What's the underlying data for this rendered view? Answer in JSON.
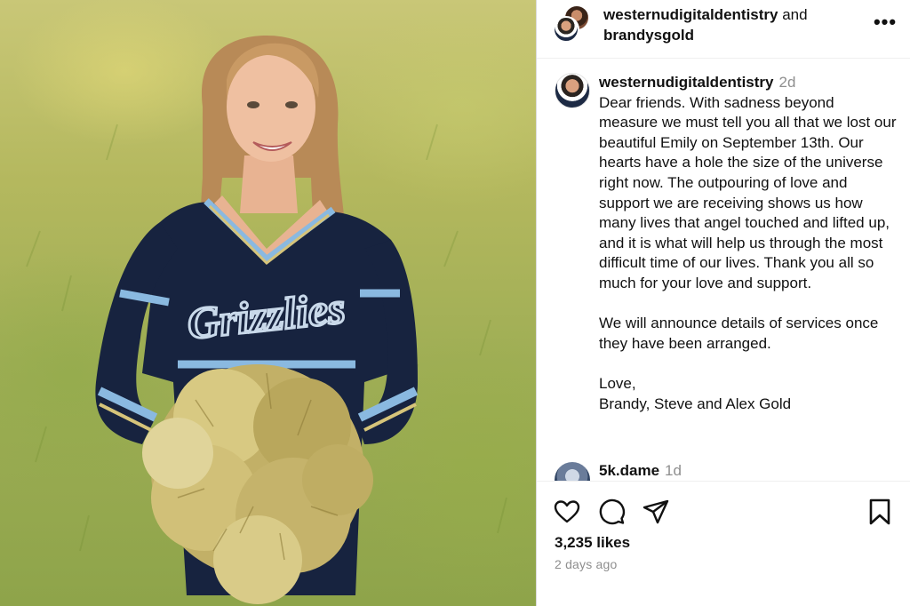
{
  "header": {
    "user1": "westernudigitaldentistry",
    "joiner": "and",
    "user2": "brandysgold",
    "more_label": "•••"
  },
  "post": {
    "username": "westernudigitaldentistry",
    "time": "2d",
    "caption_p1": "Dear friends. With sadness beyond measure we must tell you all that we lost our beautiful Emily on September 13th. Our hearts have a hole the size of the universe right now. The outpouring of love and support we are receiving shows us how many lives that angel touched and lifted up, and it is what will help us through the most difficult time of our lives. Thank you all so much for your love and support.",
    "caption_p2": "We will announce details of services once they have been arranged.",
    "caption_p3": "Love,\nBrandy, Steve and Alex Gold"
  },
  "comment": {
    "username": "5k.dame",
    "time": "1d"
  },
  "photo": {
    "jersey_text": "Grizzlies"
  },
  "actions": {
    "icons": [
      "heart-icon",
      "comment-icon",
      "share-icon",
      "bookmark-icon"
    ],
    "likes": "3,235 likes",
    "posted": "2 days ago"
  },
  "colors": {
    "uniform_navy": "#17233f",
    "uniform_lightblue": "#8ab9e0",
    "pompom_gold": "#c9b56a",
    "meta_gray": "#8e8e8e"
  }
}
